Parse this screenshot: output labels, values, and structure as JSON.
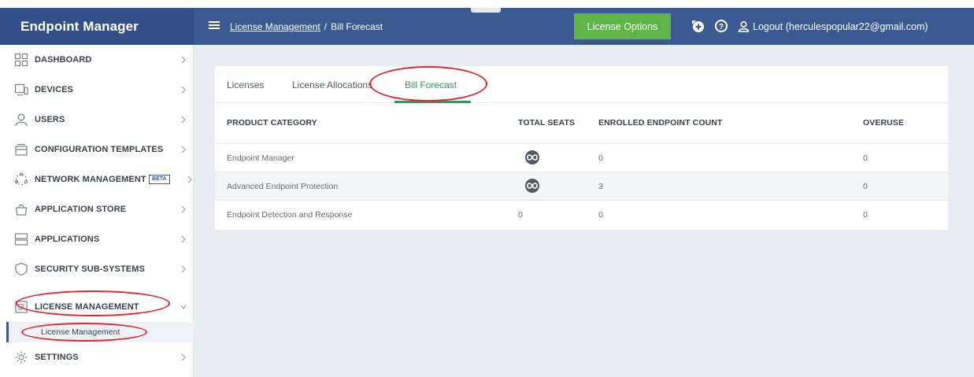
{
  "header": {
    "brand": "Endpoint Manager",
    "breadcrumb_link": "License Management",
    "breadcrumb_sep": "/",
    "breadcrumb_current": "Bill Forecast",
    "license_options_label": "License Options",
    "logout_label": "Logout (herculespopular22@gmail.com)",
    "colors": {
      "bar": "#3c5a92",
      "brand_bg": "#34508a",
      "button": "#5fb548"
    },
    "icons": [
      "menu-icon",
      "add-icon",
      "help-icon",
      "user-icon"
    ]
  },
  "sidebar": {
    "items": [
      {
        "label": "DASHBOARD",
        "icon": "dashboard-icon"
      },
      {
        "label": "DEVICES",
        "icon": "devices-icon"
      },
      {
        "label": "USERS",
        "icon": "user-icon"
      },
      {
        "label": "CONFIGURATION TEMPLATES",
        "icon": "template-icon"
      },
      {
        "label": "NETWORK MANAGEMENT",
        "icon": "network-icon",
        "badge": "BETA"
      },
      {
        "label": "APPLICATION STORE",
        "icon": "store-icon"
      },
      {
        "label": "APPLICATIONS",
        "icon": "applications-icon"
      },
      {
        "label": "SECURITY SUB-SYSTEMS",
        "icon": "shield-icon"
      },
      {
        "label": "LICENSE MANAGEMENT",
        "icon": "license-icon",
        "expanded": true
      },
      {
        "label": "SETTINGS",
        "icon": "gear-icon"
      }
    ],
    "sub_item": "License Management"
  },
  "tabs": [
    {
      "label": "Licenses"
    },
    {
      "label": "License Allocations"
    },
    {
      "label": "Bill Forecast",
      "active": true
    }
  ],
  "table": {
    "columns": [
      "PRODUCT CATEGORY",
      "TOTAL SEATS",
      "ENROLLED ENDPOINT COUNT",
      "OVERUSE"
    ],
    "rows": [
      {
        "category": "Endpoint Manager",
        "total_seats": "infinite-icon",
        "enrolled": "0",
        "overuse": "0"
      },
      {
        "category": "Advanced Endpoint Protection",
        "total_seats": "infinite-icon",
        "enrolled": "3",
        "overuse": "0"
      },
      {
        "category": "Endpoint Detection and Response",
        "total_seats": "0",
        "enrolled": "0",
        "overuse": "0"
      }
    ]
  }
}
